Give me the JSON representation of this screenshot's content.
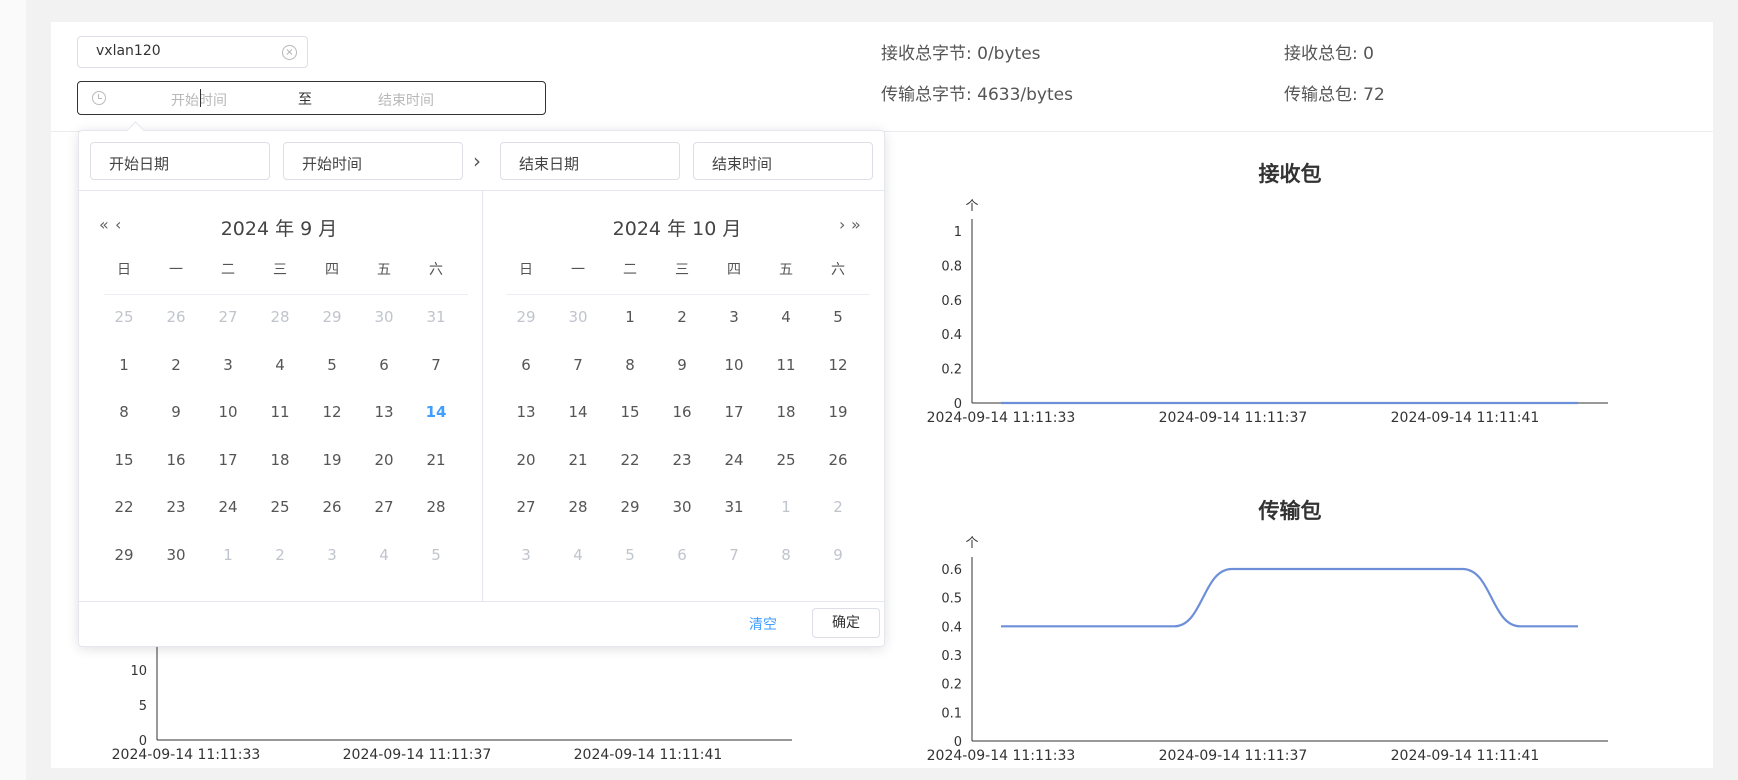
{
  "filter": {
    "interface_value": "vxlan120",
    "start_placeholder": "开始时间",
    "separator": "至",
    "end_placeholder": "结束时间"
  },
  "stats": [
    {
      "label": "接收总字节:",
      "value": "0/bytes"
    },
    {
      "label": "接收总包:",
      "value": "0"
    },
    {
      "label": "传输总字节:",
      "value": "4633/bytes"
    },
    {
      "label": "传输总包:",
      "value": "72"
    }
  ],
  "picker": {
    "start_date_placeholder": "开始日期",
    "start_time_placeholder": "开始时间",
    "end_date_placeholder": "结束日期",
    "end_time_placeholder": "结束时间",
    "weekdays": [
      "日",
      "一",
      "二",
      "三",
      "四",
      "五",
      "六"
    ],
    "left_title": "2024 年 9 月",
    "right_title": "2024 年 10 月",
    "left_days": [
      [
        "25",
        "26",
        "27",
        "28",
        "29",
        "30",
        "31"
      ],
      [
        "1",
        "2",
        "3",
        "4",
        "5",
        "6",
        "7"
      ],
      [
        "8",
        "9",
        "10",
        "11",
        "12",
        "13",
        "14"
      ],
      [
        "15",
        "16",
        "17",
        "18",
        "19",
        "20",
        "21"
      ],
      [
        "22",
        "23",
        "24",
        "25",
        "26",
        "27",
        "28"
      ],
      [
        "29",
        "30",
        "1",
        "2",
        "3",
        "4",
        "5"
      ]
    ],
    "right_days": [
      [
        "29",
        "30",
        "1",
        "2",
        "3",
        "4",
        "5"
      ],
      [
        "6",
        "7",
        "8",
        "9",
        "10",
        "11",
        "12"
      ],
      [
        "13",
        "14",
        "15",
        "16",
        "17",
        "18",
        "19"
      ],
      [
        "20",
        "21",
        "22",
        "23",
        "24",
        "25",
        "26"
      ],
      [
        "27",
        "28",
        "29",
        "30",
        "31",
        "1",
        "2"
      ],
      [
        "3",
        "4",
        "5",
        "6",
        "7",
        "8",
        "9"
      ]
    ],
    "today": "14",
    "clear_label": "清空",
    "confirm_label": "确定",
    "accent": "#409eff"
  },
  "chart_data": [
    {
      "type": "line",
      "title": "接收包",
      "ylabel": "个",
      "yticks": [
        "0",
        "0.2",
        "0.4",
        "0.6",
        "0.8",
        "1"
      ],
      "ylim": [
        0,
        1
      ],
      "x_tick_labels": [
        "2024-09-14 11:11:33",
        "2024-09-14 11:11:37",
        "2024-09-14 11:11:41"
      ],
      "x": [
        "11:11:33",
        "11:11:34",
        "11:11:35",
        "11:11:36",
        "11:11:37",
        "11:11:38",
        "11:11:39",
        "11:11:40",
        "11:11:41",
        "11:11:42",
        "11:11:43"
      ],
      "series": [
        {
          "values": [
            0,
            0,
            0,
            0,
            0,
            0,
            0,
            0,
            0,
            0,
            0
          ],
          "color": "#6d8fd8"
        }
      ]
    },
    {
      "type": "line",
      "title": "传输包",
      "ylabel": "个",
      "yticks": [
        "0",
        "0.1",
        "0.2",
        "0.3",
        "0.4",
        "0.5",
        "0.6"
      ],
      "ylim": [
        0,
        0.6
      ],
      "x_tick_labels": [
        "2024-09-14 11:11:33",
        "2024-09-14 11:11:37",
        "2024-09-14 11:11:41"
      ],
      "x": [
        "11:11:33",
        "11:11:34",
        "11:11:35",
        "11:11:36",
        "11:11:37",
        "11:11:38",
        "11:11:39",
        "11:11:40",
        "11:11:41",
        "11:11:42",
        "11:11:43"
      ],
      "series": [
        {
          "values": [
            0.4,
            0.4,
            0.4,
            0.4,
            0.6,
            0.6,
            0.6,
            0.6,
            0.6,
            0.4,
            0.4
          ],
          "color": "#6d8fd8"
        }
      ]
    },
    {
      "type": "line",
      "yticks": [
        "0",
        "5",
        "10"
      ],
      "ylim": [
        0,
        10
      ],
      "x_tick_labels": [
        "2024-09-14 11:11:33",
        "2024-09-14 11:11:37",
        "2024-09-14 11:11:41"
      ]
    }
  ]
}
